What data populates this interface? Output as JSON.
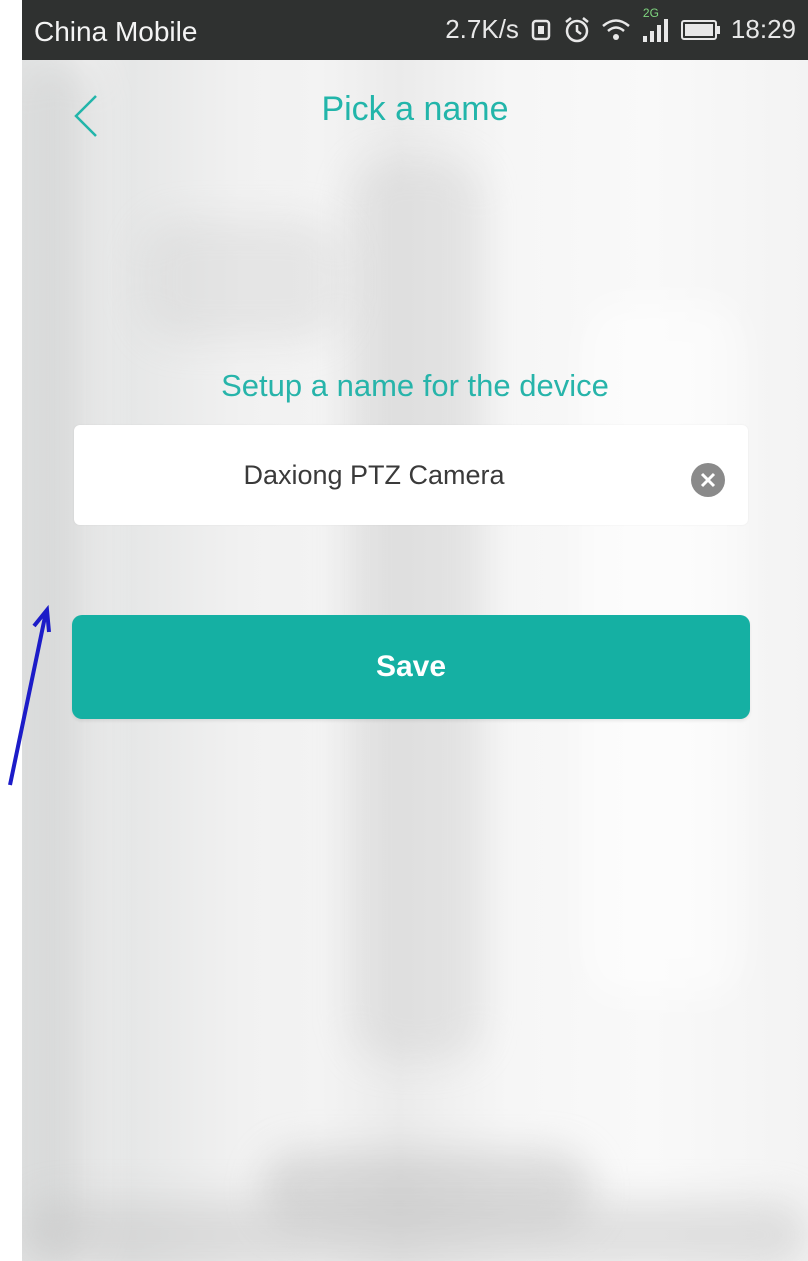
{
  "status_bar": {
    "carrier": "China Mobile",
    "network_speed": "2.7K/s",
    "network_type": "2G",
    "time": "18:29",
    "icons": [
      "sync-icon",
      "alarm-icon",
      "wifi-icon",
      "signal-icon",
      "battery-icon"
    ]
  },
  "nav": {
    "title": "Pick a name",
    "back_icon": "chevron-left-icon"
  },
  "form": {
    "prompt": "Setup a name for the device",
    "device_name_value": "Daxiong PTZ Camera",
    "clear_icon": "clear-icon",
    "save_label": "Save"
  },
  "colors": {
    "accent": "#15b0a3",
    "title_text": "#22b5aa",
    "status_bar": "#2f3130",
    "annotation_arrow": "#1c1cc8"
  }
}
